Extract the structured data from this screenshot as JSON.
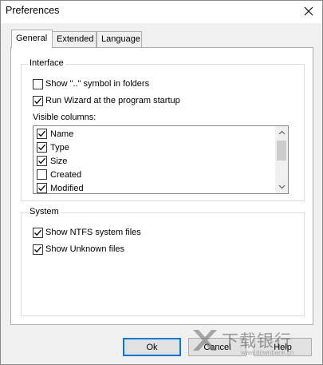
{
  "window": {
    "title": "Preferences"
  },
  "tabs": [
    {
      "label": "General",
      "active": true
    },
    {
      "label": "Extended",
      "active": false
    },
    {
      "label": "Language",
      "active": false
    }
  ],
  "interface": {
    "group_label": "Interface",
    "show_dotdot": {
      "label": "Show \"..\" symbol in folders",
      "checked": false
    },
    "run_wizard": {
      "label": "Run Wizard at the program startup",
      "checked": true
    },
    "visible_columns_label": "Visible columns:",
    "columns": [
      {
        "label": "Name",
        "checked": true
      },
      {
        "label": "Type",
        "checked": true
      },
      {
        "label": "Size",
        "checked": true
      },
      {
        "label": "Created",
        "checked": false
      },
      {
        "label": "Modified",
        "checked": true
      }
    ]
  },
  "system": {
    "group_label": "System",
    "show_ntfs": {
      "label": "Show NTFS system files",
      "checked": true
    },
    "show_unknown": {
      "label": "Show Unknown files",
      "checked": true
    }
  },
  "buttons": {
    "ok": "Ok",
    "cancel": "Cancel",
    "help": "Help"
  },
  "watermark": {
    "text": "下载银行",
    "url": "www.downbank.cn"
  }
}
